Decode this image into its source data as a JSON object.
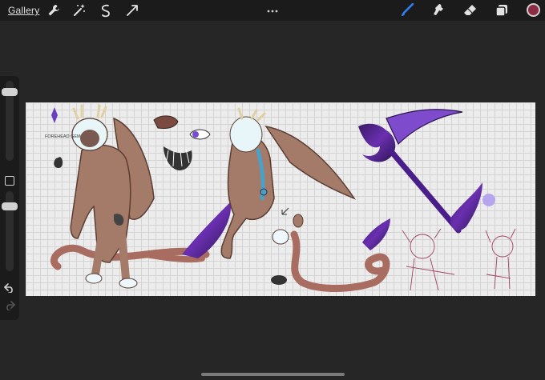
{
  "toolbar": {
    "gallery_label": "Gallery",
    "left_tools": [
      "wrench-icon",
      "magic-wand-icon",
      "selection-icon",
      "transform-icon"
    ],
    "right_tools": [
      "brush-icon",
      "smudge-icon",
      "eraser-icon",
      "layers-icon"
    ],
    "active_tool": "brush",
    "current_color": "#8e2a42",
    "accent_color": "#2f7ef5"
  },
  "sidebar": {
    "brush_size_level": 0.9,
    "opacity_level": 0.85
  },
  "canvas": {
    "annotation_text": "FOREHEAD GEM",
    "background_color": "#ececec"
  }
}
